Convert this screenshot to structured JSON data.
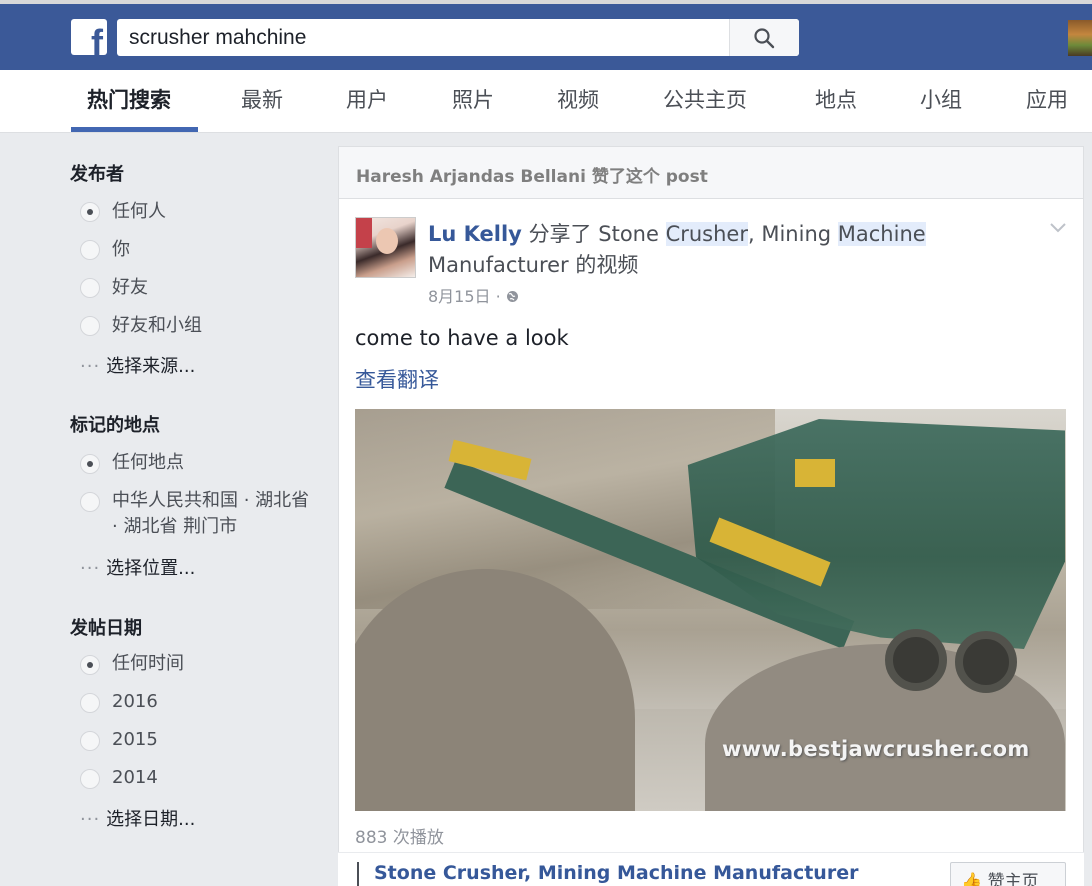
{
  "search": {
    "query": "scrusher mahchine"
  },
  "tabs": [
    {
      "label": "热门搜索",
      "active": true
    },
    {
      "label": "最新"
    },
    {
      "label": "用户"
    },
    {
      "label": "照片"
    },
    {
      "label": "视频"
    },
    {
      "label": "公共主页"
    },
    {
      "label": "地点"
    },
    {
      "label": "小组"
    },
    {
      "label": "应用"
    }
  ],
  "filters": {
    "publisher": {
      "title": "发布者",
      "options": [
        "任何人",
        "你",
        "好友",
        "好友和小组"
      ],
      "selected": 0,
      "more": "选择来源..."
    },
    "location": {
      "title": "标记的地点",
      "options": [
        "任何地点",
        "中华人民共和国 · 湖北省 · 湖北省 荆门市"
      ],
      "selected": 0,
      "more": "选择位置..."
    },
    "date": {
      "title": "发帖日期",
      "options": [
        "任何时间",
        "2016",
        "2015",
        "2014"
      ],
      "selected": 0,
      "more": "选择日期..."
    }
  },
  "result": {
    "context": "Haresh Arjandas Bellani 赞了这个 post",
    "author": "Lu Kelly",
    "shared_text": "分享了",
    "page_prefix": "Stone ",
    "page_hl1": "Crusher",
    "page_mid": ", Mining ",
    "page_hl2": "Machine",
    "page_line2": "Manufacturer",
    "suffix": "的视频",
    "date": "8月15日",
    "message": "come to have a look",
    "translate": "查看翻译",
    "watermark": "www.bestjawcrusher.com",
    "views": "883 次播放",
    "page_link": "Stone Crusher, Mining Machine Manufacturer",
    "like_page": "赞主页"
  },
  "colors": {
    "fb_blue": "#3b5998",
    "link_blue": "#365899",
    "highlight": "#e3ecfb"
  }
}
